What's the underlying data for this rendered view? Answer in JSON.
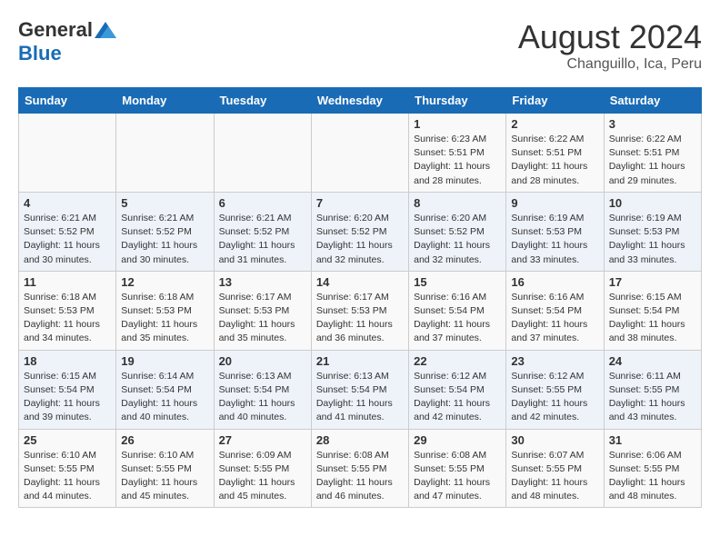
{
  "header": {
    "logo_general": "General",
    "logo_blue": "Blue",
    "title": "August 2024",
    "subtitle": "Changuillo, Ica, Peru"
  },
  "days_of_week": [
    "Sunday",
    "Monday",
    "Tuesday",
    "Wednesday",
    "Thursday",
    "Friday",
    "Saturday"
  ],
  "weeks": [
    [
      {
        "day": "",
        "detail": ""
      },
      {
        "day": "",
        "detail": ""
      },
      {
        "day": "",
        "detail": ""
      },
      {
        "day": "",
        "detail": ""
      },
      {
        "day": "1",
        "detail": "Sunrise: 6:23 AM\nSunset: 5:51 PM\nDaylight: 11 hours\nand 28 minutes."
      },
      {
        "day": "2",
        "detail": "Sunrise: 6:22 AM\nSunset: 5:51 PM\nDaylight: 11 hours\nand 28 minutes."
      },
      {
        "day": "3",
        "detail": "Sunrise: 6:22 AM\nSunset: 5:51 PM\nDaylight: 11 hours\nand 29 minutes."
      }
    ],
    [
      {
        "day": "4",
        "detail": "Sunrise: 6:21 AM\nSunset: 5:52 PM\nDaylight: 11 hours\nand 30 minutes."
      },
      {
        "day": "5",
        "detail": "Sunrise: 6:21 AM\nSunset: 5:52 PM\nDaylight: 11 hours\nand 30 minutes."
      },
      {
        "day": "6",
        "detail": "Sunrise: 6:21 AM\nSunset: 5:52 PM\nDaylight: 11 hours\nand 31 minutes."
      },
      {
        "day": "7",
        "detail": "Sunrise: 6:20 AM\nSunset: 5:52 PM\nDaylight: 11 hours\nand 32 minutes."
      },
      {
        "day": "8",
        "detail": "Sunrise: 6:20 AM\nSunset: 5:52 PM\nDaylight: 11 hours\nand 32 minutes."
      },
      {
        "day": "9",
        "detail": "Sunrise: 6:19 AM\nSunset: 5:53 PM\nDaylight: 11 hours\nand 33 minutes."
      },
      {
        "day": "10",
        "detail": "Sunrise: 6:19 AM\nSunset: 5:53 PM\nDaylight: 11 hours\nand 33 minutes."
      }
    ],
    [
      {
        "day": "11",
        "detail": "Sunrise: 6:18 AM\nSunset: 5:53 PM\nDaylight: 11 hours\nand 34 minutes."
      },
      {
        "day": "12",
        "detail": "Sunrise: 6:18 AM\nSunset: 5:53 PM\nDaylight: 11 hours\nand 35 minutes."
      },
      {
        "day": "13",
        "detail": "Sunrise: 6:17 AM\nSunset: 5:53 PM\nDaylight: 11 hours\nand 35 minutes."
      },
      {
        "day": "14",
        "detail": "Sunrise: 6:17 AM\nSunset: 5:53 PM\nDaylight: 11 hours\nand 36 minutes."
      },
      {
        "day": "15",
        "detail": "Sunrise: 6:16 AM\nSunset: 5:54 PM\nDaylight: 11 hours\nand 37 minutes."
      },
      {
        "day": "16",
        "detail": "Sunrise: 6:16 AM\nSunset: 5:54 PM\nDaylight: 11 hours\nand 37 minutes."
      },
      {
        "day": "17",
        "detail": "Sunrise: 6:15 AM\nSunset: 5:54 PM\nDaylight: 11 hours\nand 38 minutes."
      }
    ],
    [
      {
        "day": "18",
        "detail": "Sunrise: 6:15 AM\nSunset: 5:54 PM\nDaylight: 11 hours\nand 39 minutes."
      },
      {
        "day": "19",
        "detail": "Sunrise: 6:14 AM\nSunset: 5:54 PM\nDaylight: 11 hours\nand 40 minutes."
      },
      {
        "day": "20",
        "detail": "Sunrise: 6:13 AM\nSunset: 5:54 PM\nDaylight: 11 hours\nand 40 minutes."
      },
      {
        "day": "21",
        "detail": "Sunrise: 6:13 AM\nSunset: 5:54 PM\nDaylight: 11 hours\nand 41 minutes."
      },
      {
        "day": "22",
        "detail": "Sunrise: 6:12 AM\nSunset: 5:54 PM\nDaylight: 11 hours\nand 42 minutes."
      },
      {
        "day": "23",
        "detail": "Sunrise: 6:12 AM\nSunset: 5:55 PM\nDaylight: 11 hours\nand 42 minutes."
      },
      {
        "day": "24",
        "detail": "Sunrise: 6:11 AM\nSunset: 5:55 PM\nDaylight: 11 hours\nand 43 minutes."
      }
    ],
    [
      {
        "day": "25",
        "detail": "Sunrise: 6:10 AM\nSunset: 5:55 PM\nDaylight: 11 hours\nand 44 minutes."
      },
      {
        "day": "26",
        "detail": "Sunrise: 6:10 AM\nSunset: 5:55 PM\nDaylight: 11 hours\nand 45 minutes."
      },
      {
        "day": "27",
        "detail": "Sunrise: 6:09 AM\nSunset: 5:55 PM\nDaylight: 11 hours\nand 45 minutes."
      },
      {
        "day": "28",
        "detail": "Sunrise: 6:08 AM\nSunset: 5:55 PM\nDaylight: 11 hours\nand 46 minutes."
      },
      {
        "day": "29",
        "detail": "Sunrise: 6:08 AM\nSunset: 5:55 PM\nDaylight: 11 hours\nand 47 minutes."
      },
      {
        "day": "30",
        "detail": "Sunrise: 6:07 AM\nSunset: 5:55 PM\nDaylight: 11 hours\nand 48 minutes."
      },
      {
        "day": "31",
        "detail": "Sunrise: 6:06 AM\nSunset: 5:55 PM\nDaylight: 11 hours\nand 48 minutes."
      }
    ]
  ]
}
